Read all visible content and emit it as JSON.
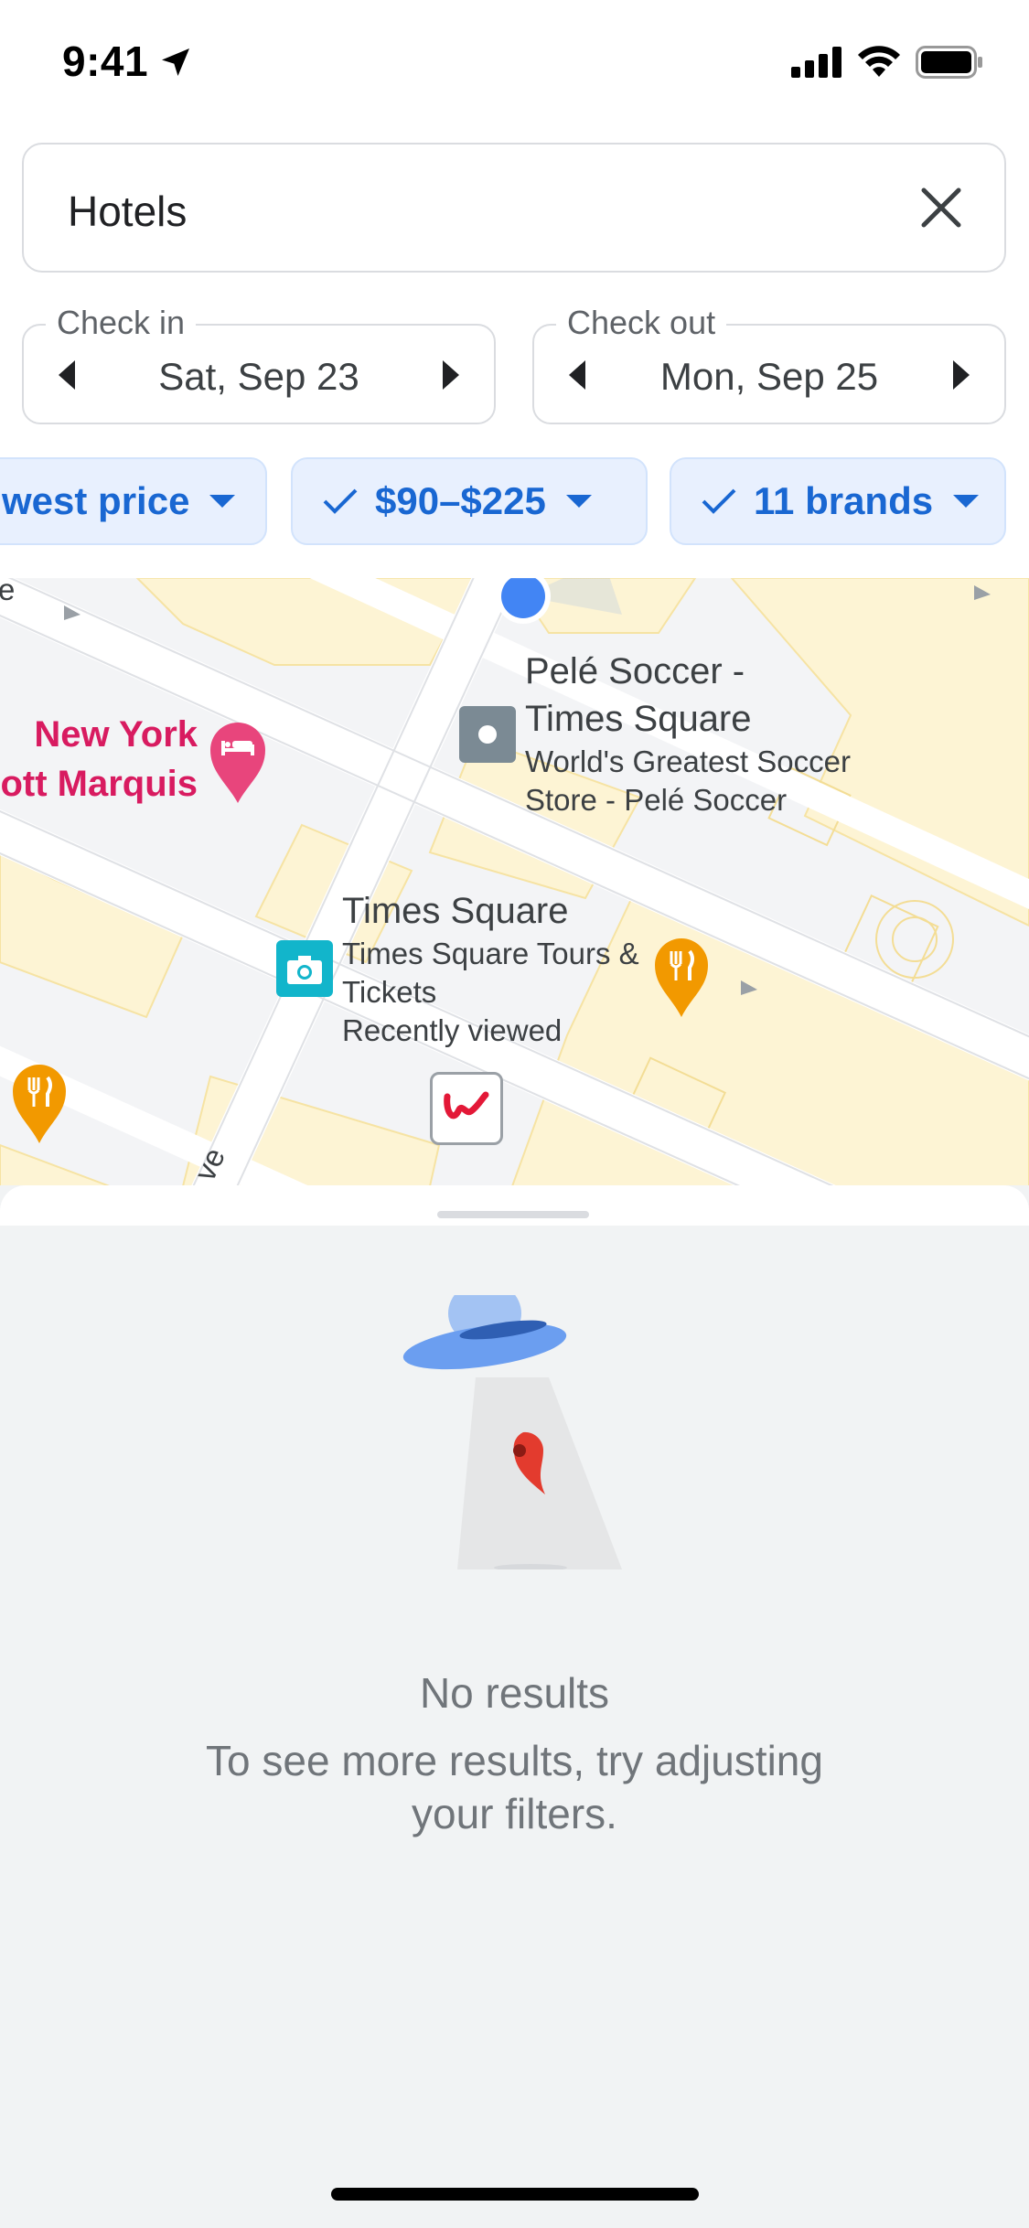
{
  "status_bar": {
    "time": "9:41"
  },
  "search": {
    "query": "Hotels"
  },
  "dates": {
    "check_in": {
      "label": "Check in",
      "value": "Sat, Sep 23"
    },
    "check_out": {
      "label": "Check out",
      "value": "Mon, Sep 25"
    }
  },
  "filters": [
    {
      "label": "west price",
      "checked": false
    },
    {
      "label": "$90–$225",
      "checked": true
    },
    {
      "label": "11 brands",
      "checked": true
    }
  ],
  "map": {
    "places": {
      "pele": {
        "title": "Pelé Soccer -\nTimes Square",
        "sub": "World's Greatest Soccer\nStore - Pelé Soccer"
      },
      "times_square": {
        "title": "Times Square",
        "sub": "Times Square Tours &\nTickets",
        "note": "Recently viewed"
      },
      "hotel": {
        "line1": "New York",
        "line2": "ott Marquis"
      }
    },
    "street_fragment": "ve",
    "street_fragment_top": "e",
    "colors": {
      "hotel_pin": "#e8457c",
      "food_pin": "#f29900",
      "attraction": "#12b5cb",
      "store": "#7b8a94",
      "location_dot": "#4285f4"
    }
  },
  "results": {
    "title": "No results",
    "hint": "To see more results, try adjusting your filters."
  }
}
